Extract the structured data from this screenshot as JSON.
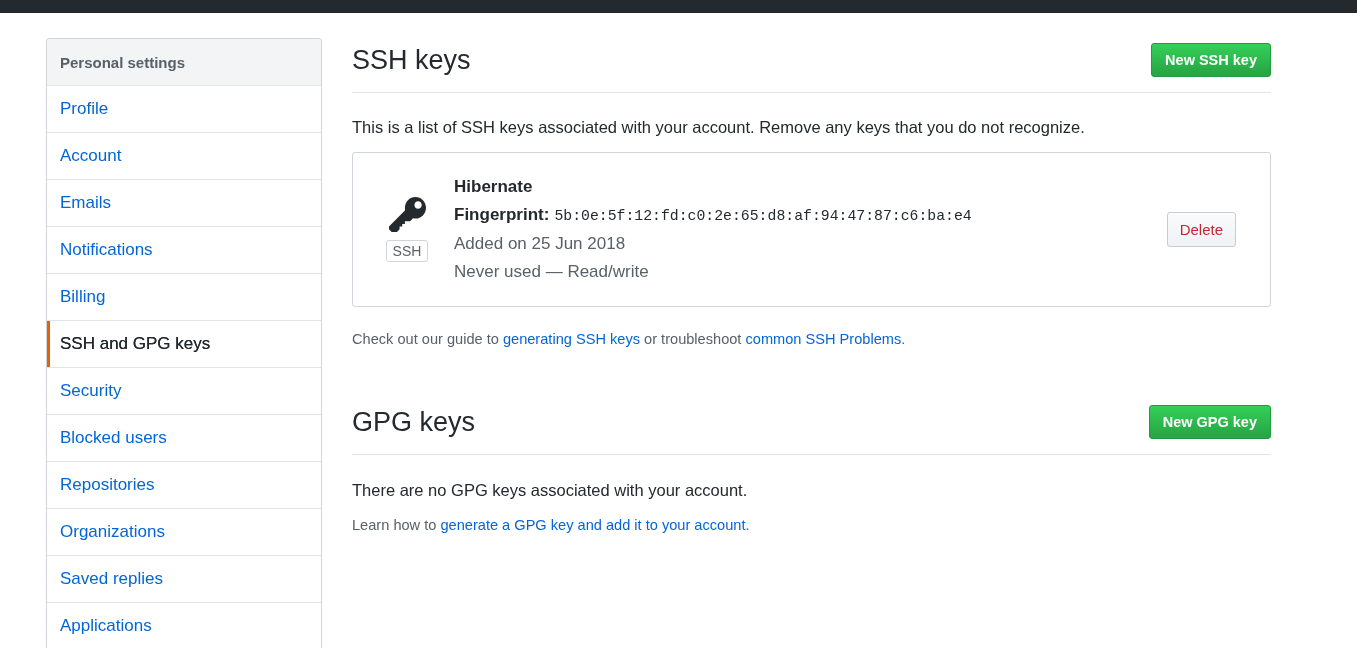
{
  "sidebar": {
    "heading": "Personal settings",
    "items": [
      {
        "label": "Profile",
        "selected": false
      },
      {
        "label": "Account",
        "selected": false
      },
      {
        "label": "Emails",
        "selected": false
      },
      {
        "label": "Notifications",
        "selected": false
      },
      {
        "label": "Billing",
        "selected": false
      },
      {
        "label": "SSH and GPG keys",
        "selected": true
      },
      {
        "label": "Security",
        "selected": false
      },
      {
        "label": "Blocked users",
        "selected": false
      },
      {
        "label": "Repositories",
        "selected": false
      },
      {
        "label": "Organizations",
        "selected": false
      },
      {
        "label": "Saved replies",
        "selected": false
      },
      {
        "label": "Applications",
        "selected": false
      }
    ]
  },
  "ssh_keys": {
    "title": "SSH keys",
    "new_button": "New SSH key",
    "description": "This is a list of SSH keys associated with your account. Remove any keys that you do not recognize.",
    "keys": [
      {
        "name": "Hibernate",
        "fingerprint_label": "Fingerprint:",
        "fingerprint": "5b:0e:5f:12:fd:c0:2e:65:d8:af:94:47:87:c6:ba:e4",
        "badge": "SSH",
        "added": "Added on 25 Jun 2018",
        "usage": "Never used — Read/write",
        "delete_button": "Delete"
      }
    ],
    "help": [
      {
        "kind": "text",
        "text": "Check out our guide to "
      },
      {
        "kind": "link",
        "text": "generating SSH keys"
      },
      {
        "kind": "text",
        "text": " or troubleshoot "
      },
      {
        "kind": "link",
        "text": "common SSH Problems"
      },
      {
        "kind": "text",
        "text": "."
      }
    ]
  },
  "gpg_keys": {
    "title": "GPG keys",
    "new_button": "New GPG key",
    "empty_message": "There are no GPG keys associated with your account.",
    "help": [
      {
        "kind": "text",
        "text": "Learn how to "
      },
      {
        "kind": "link",
        "text": "generate a GPG key and add it to your account"
      },
      {
        "kind": "text",
        "text": "."
      }
    ]
  }
}
